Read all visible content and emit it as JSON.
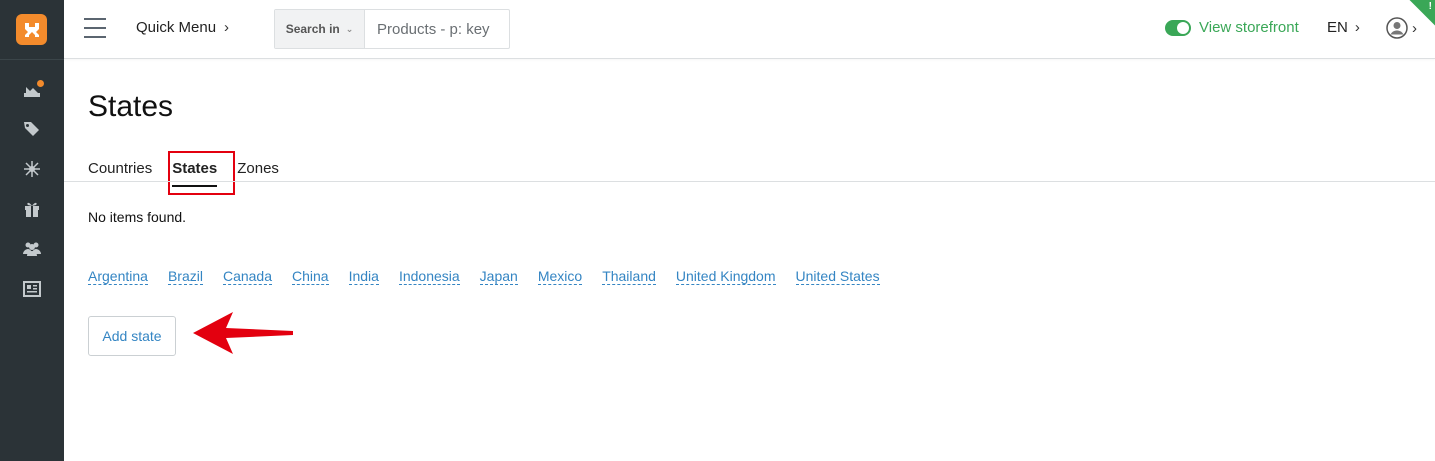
{
  "sidebar": {
    "icons": [
      "dashboard-icon",
      "tags-icon",
      "network-icon",
      "gift-icon",
      "users-icon",
      "news-icon"
    ]
  },
  "topbar": {
    "quick_menu": "Quick Menu",
    "search_in": "Search in",
    "search_placeholder": "Products - p: key",
    "view_storefront": "View storefront",
    "language": "EN"
  },
  "page": {
    "title": "States",
    "tabs": [
      {
        "label": "Countries",
        "active": false
      },
      {
        "label": "States",
        "active": true
      },
      {
        "label": "Zones",
        "active": false
      }
    ],
    "empty_text": "No items found.",
    "countries": [
      "Argentina",
      "Brazil",
      "Canada",
      "China",
      "India",
      "Indonesia",
      "Japan",
      "Mexico",
      "Thailand",
      "United Kingdom",
      "United States"
    ],
    "add_button": "Add state"
  },
  "colors": {
    "accent_orange": "#f38b2c",
    "link_blue": "#3485c3",
    "storefront_green": "#3aa757",
    "highlight_red": "#e3000f"
  }
}
